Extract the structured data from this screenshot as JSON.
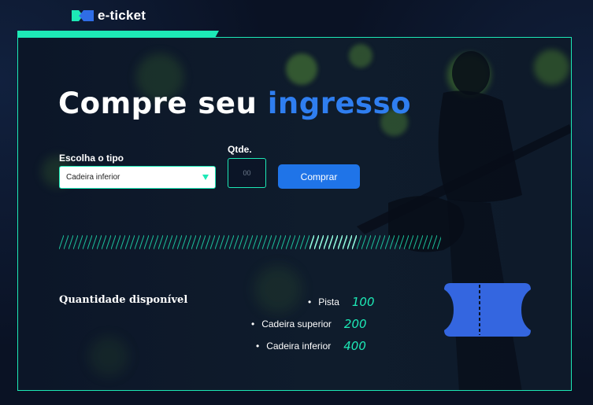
{
  "brand": {
    "name": "e-ticket"
  },
  "hero": {
    "title_main": "Compre seu",
    "title_accent": "ingresso"
  },
  "form": {
    "type_label": "Escolha o tipo",
    "type_selected": "Cadeira inferior",
    "qty_label": "Qtde.",
    "qty_placeholder": "00",
    "buy_label": "Comprar"
  },
  "availability": {
    "title": "Quantidade disponível",
    "items": [
      {
        "name": "Pista",
        "value": "100"
      },
      {
        "name": "Cadeira superior",
        "value": "200"
      },
      {
        "name": "Cadeira inferior",
        "value": "400"
      }
    ]
  },
  "colors": {
    "accent_teal": "#1de9b6",
    "accent_blue": "#2f7ef0",
    "button_blue": "#1f74e8",
    "ticket_blue": "#3466e0",
    "background": "#0a1224"
  },
  "icons": {
    "logo": "ticket-logo-icon",
    "ticket": "ticket-icon",
    "select_arrow": "chevron-down-icon"
  }
}
